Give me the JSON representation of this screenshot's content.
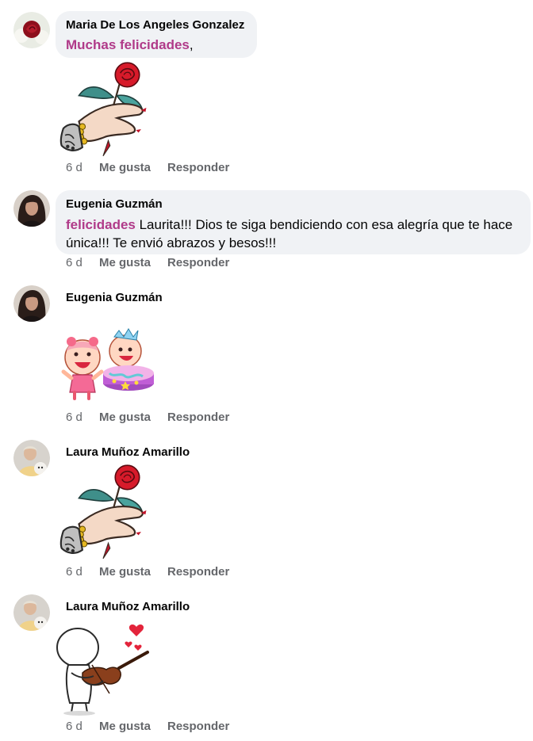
{
  "comments": [
    {
      "author": "Maria De Los Angeles Gonzalez",
      "highlight": "Muchas felicidades",
      "text": ",",
      "sticker": "rose-hand-sticker",
      "time": "6 d",
      "like": "Me gusta",
      "reply": "Responder"
    },
    {
      "author": "Eugenia Guzmán",
      "highlight": "felicidades",
      "text": " Laurita!!! Dios te siga bendiciendo con esa alegría que te hace única!!! Te envió abrazos y besos!!!",
      "time": "6 d",
      "like": "Me gusta",
      "reply": "Responder"
    },
    {
      "author": "Eugenia Guzmán",
      "sticker": "candy-crush-birthday-sticker",
      "time": "6 d",
      "like": "Me gusta",
      "reply": "Responder"
    },
    {
      "author": "Laura Muñoz Amarillo",
      "sticker": "rose-hand-sticker",
      "time": "6 d",
      "like": "Me gusta",
      "reply": "Responder"
    },
    {
      "author": "Laura Muñoz Amarillo",
      "sticker": "violin-player-sticker",
      "time": "6 d",
      "like": "Me gusta",
      "reply": "Responder"
    }
  ],
  "colors": {
    "bubble": "#f0f2f5",
    "highlight": "#b03a89",
    "meta": "#65676b"
  }
}
